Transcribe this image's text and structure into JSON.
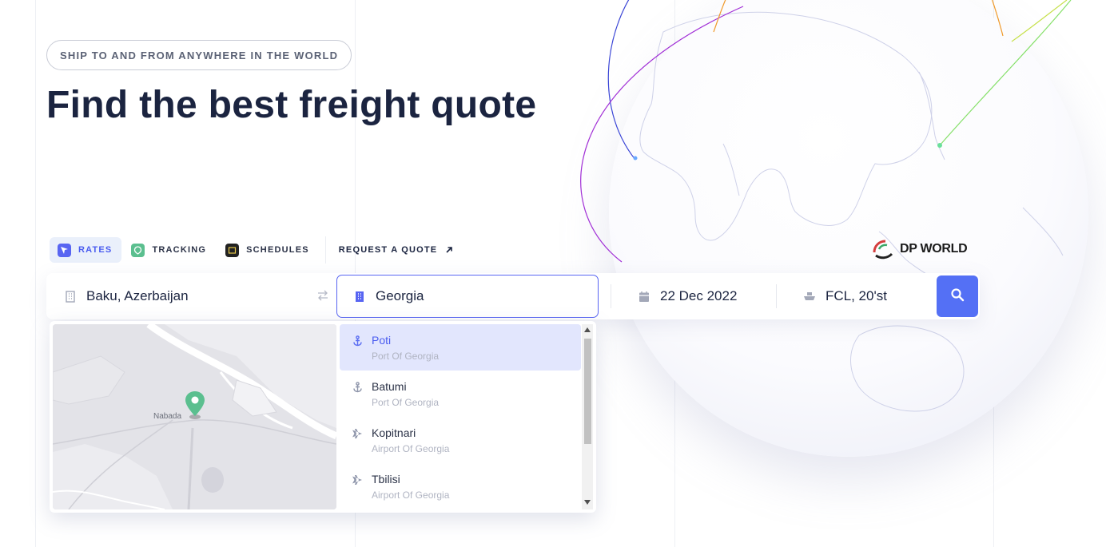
{
  "hero": {
    "pill": "SHIP TO AND FROM ANYWHERE IN THE WORLD",
    "headline": "Find the best freight quote"
  },
  "tabs": [
    {
      "label": "RATES",
      "icon": "rates-icon",
      "active": true
    },
    {
      "label": "TRACKING",
      "icon": "tracking-icon",
      "active": false
    },
    {
      "label": "SCHEDULES",
      "icon": "schedules-icon",
      "active": false
    }
  ],
  "request_quote": {
    "label": "REQUEST A QUOTE",
    "icon": "arrow-up-right-icon"
  },
  "logo": {
    "text": "DP WORLD"
  },
  "search": {
    "origin": "Baku, Azerbaijan",
    "destination": "Georgia",
    "date": "22 Dec 2022",
    "cargo": "FCL, 20'st",
    "button_icon": "search-icon"
  },
  "map": {
    "label": "Nabada"
  },
  "suggestions": [
    {
      "name": "Poti",
      "type": "Port Of Georgia",
      "icon": "anchor-icon",
      "selected": true
    },
    {
      "name": "Batumi",
      "type": "Port Of Georgia",
      "icon": "anchor-icon",
      "selected": false
    },
    {
      "name": "Kopitnari",
      "type": "Airport Of Georgia",
      "icon": "plane-icon",
      "selected": false
    },
    {
      "name": "Tbilisi",
      "type": "Airport Of Georgia",
      "icon": "plane-icon",
      "selected": false
    }
  ],
  "colors": {
    "accent": "#5865f2",
    "search_button": "#5470f5",
    "selected_row": "#e2e6fd",
    "headline": "#1b2440"
  }
}
